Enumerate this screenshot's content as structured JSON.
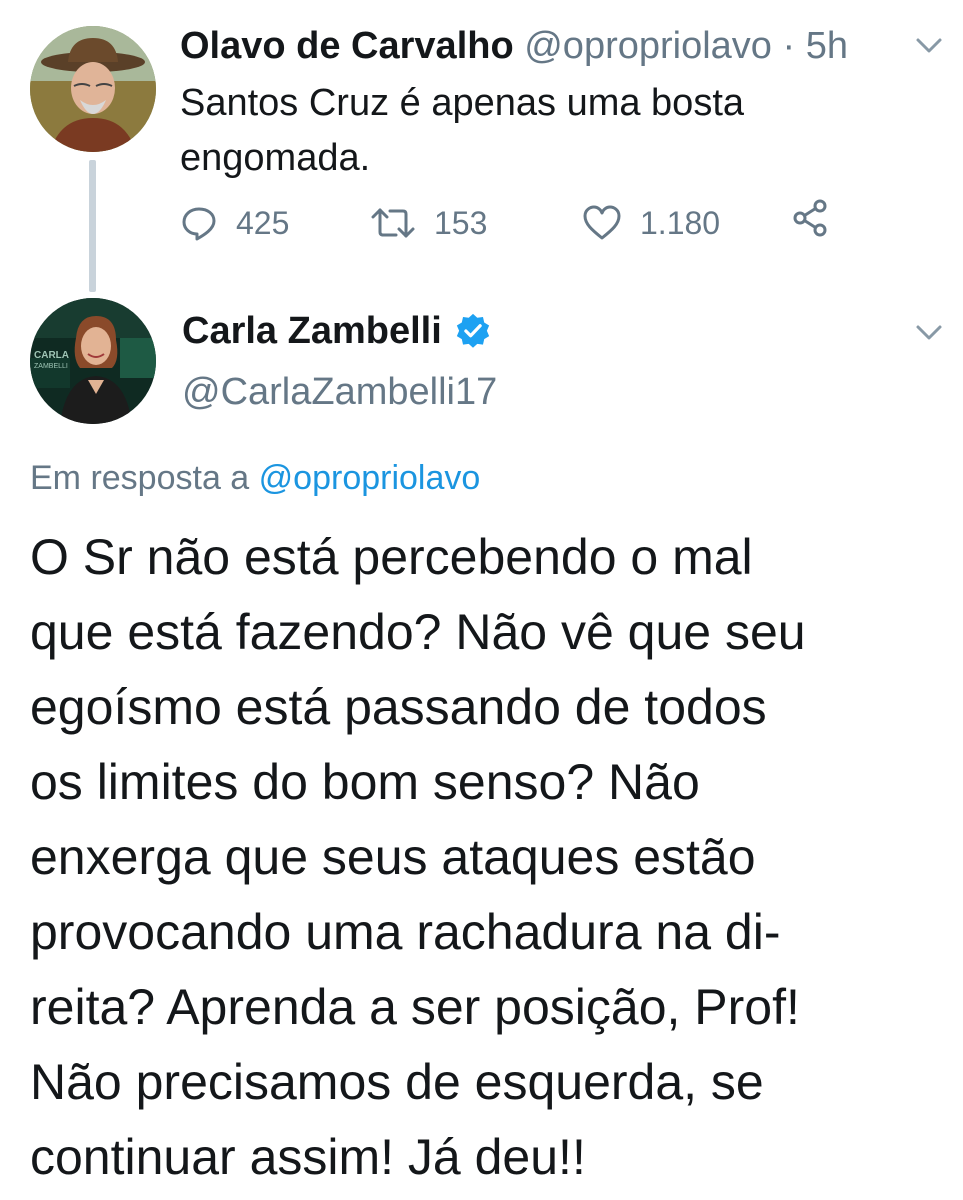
{
  "tweet1": {
    "name": "Olavo de Carvalho",
    "handle": "@opropriolavo",
    "separator": "·",
    "time": "5h",
    "text": "Santos Cruz é apenas uma bosta engomada.",
    "stats": {
      "replies": "425",
      "retweets": "153",
      "likes": "1.180"
    }
  },
  "tweet2": {
    "name": "Carla Zambelli",
    "handle": "@CarlaZambelli17",
    "verified": true,
    "reply_prefix": "Em resposta a",
    "reply_handle": "@opropriolavo",
    "text_lines": [
      "O Sr não está percebendo o mal",
      "que está fazendo? Não vê que seu",
      "egoísmo está passando de todos",
      "os limites do bom senso? Não",
      "enxerga que seus ataques estão",
      "provocando uma rachadura na di-",
      "reita? Aprenda a ser posição, Prof!",
      "Não precisamos de esquerda, se",
      "continuar assim! Já deu!!"
    ],
    "avatar_text": "CARLA ZAMBELLI"
  },
  "colors": {
    "text": "#14171a",
    "secondary": "#657786",
    "link": "#1b95e0",
    "verified": "#1da1f2",
    "thread_line": "#c9d3db"
  },
  "icons": {
    "reply": "reply-icon",
    "retweet": "retweet-icon",
    "like": "heart-icon",
    "share": "share-icon",
    "more": "chevron-down-icon",
    "verified": "verified-badge-icon"
  }
}
